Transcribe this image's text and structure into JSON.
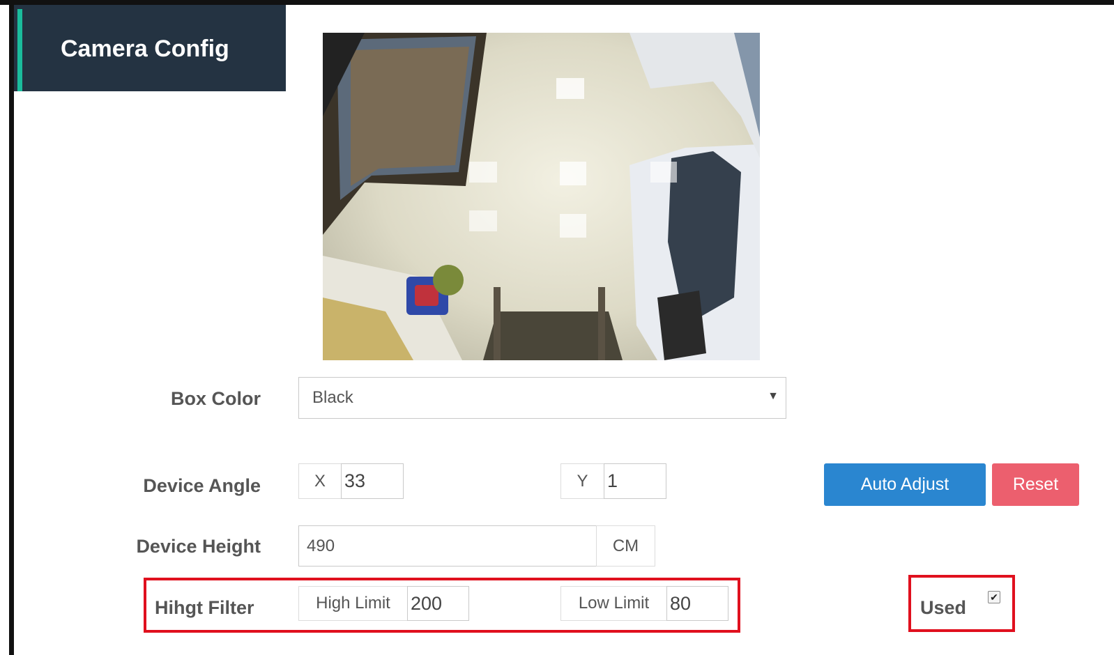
{
  "header": {
    "title": "Camera Config"
  },
  "camera": {
    "alt": "camera preview"
  },
  "box_color": {
    "label": "Box Color",
    "value": "Black",
    "arrow": "▼"
  },
  "device_angle": {
    "label": "Device Angle",
    "x_label": "X",
    "x_value": "33",
    "y_label": "Y",
    "y_value": "1"
  },
  "buttons": {
    "auto_adjust": "Auto Adjust",
    "reset": "Reset"
  },
  "device_height": {
    "label": "Device Height",
    "value": "490",
    "unit": "CM"
  },
  "height_filter": {
    "label": "Hihgt Filter",
    "high_label": "High Limit",
    "high_value": "200",
    "low_label": "Low Limit",
    "low_value": "80"
  },
  "used": {
    "label": "Used",
    "checked": true,
    "check_glyph": "✔"
  },
  "colors": {
    "header_bg": "#243342",
    "accent": "#1abc9c",
    "button_blue": "#2a86d0",
    "button_red": "#ec5f6e",
    "highlight_red": "#e0101e"
  }
}
